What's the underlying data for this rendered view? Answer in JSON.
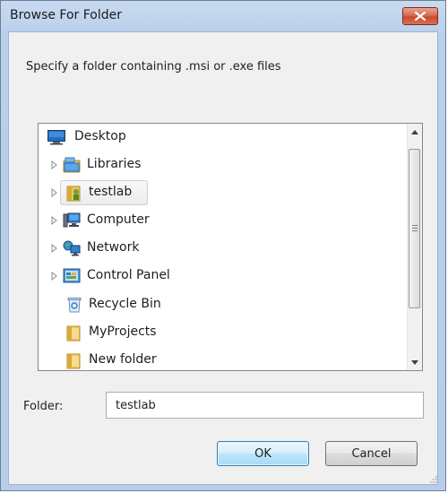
{
  "window": {
    "title": "Browse For Folder",
    "close_icon": "close-x-icon"
  },
  "instruction": "Specify a folder containing .msi or .exe files",
  "tree": {
    "items": [
      {
        "label": "Desktop",
        "icon": "desktop-icon",
        "expander": false,
        "selected": false
      },
      {
        "label": "Libraries",
        "icon": "libraries-icon",
        "expander": true,
        "selected": false
      },
      {
        "label": "testlab",
        "icon": "user-folder-icon",
        "expander": true,
        "selected": true
      },
      {
        "label": "Computer",
        "icon": "computer-icon",
        "expander": true,
        "selected": false
      },
      {
        "label": "Network",
        "icon": "network-icon",
        "expander": true,
        "selected": false
      },
      {
        "label": "Control Panel",
        "icon": "control-panel-icon",
        "expander": true,
        "selected": false
      },
      {
        "label": "Recycle Bin",
        "icon": "recycle-bin-icon",
        "expander": false,
        "selected": false
      },
      {
        "label": "MyProjects",
        "icon": "folder-icon",
        "expander": false,
        "selected": false
      },
      {
        "label": "New folder",
        "icon": "folder-icon",
        "expander": false,
        "selected": false
      }
    ]
  },
  "folder": {
    "label": "Folder:",
    "value": "testlab"
  },
  "buttons": {
    "ok": "OK",
    "cancel": "Cancel"
  },
  "colors": {
    "accent": "#3c7fb1",
    "close_red": "#c84a33",
    "window_frame": "#b9cfea"
  }
}
